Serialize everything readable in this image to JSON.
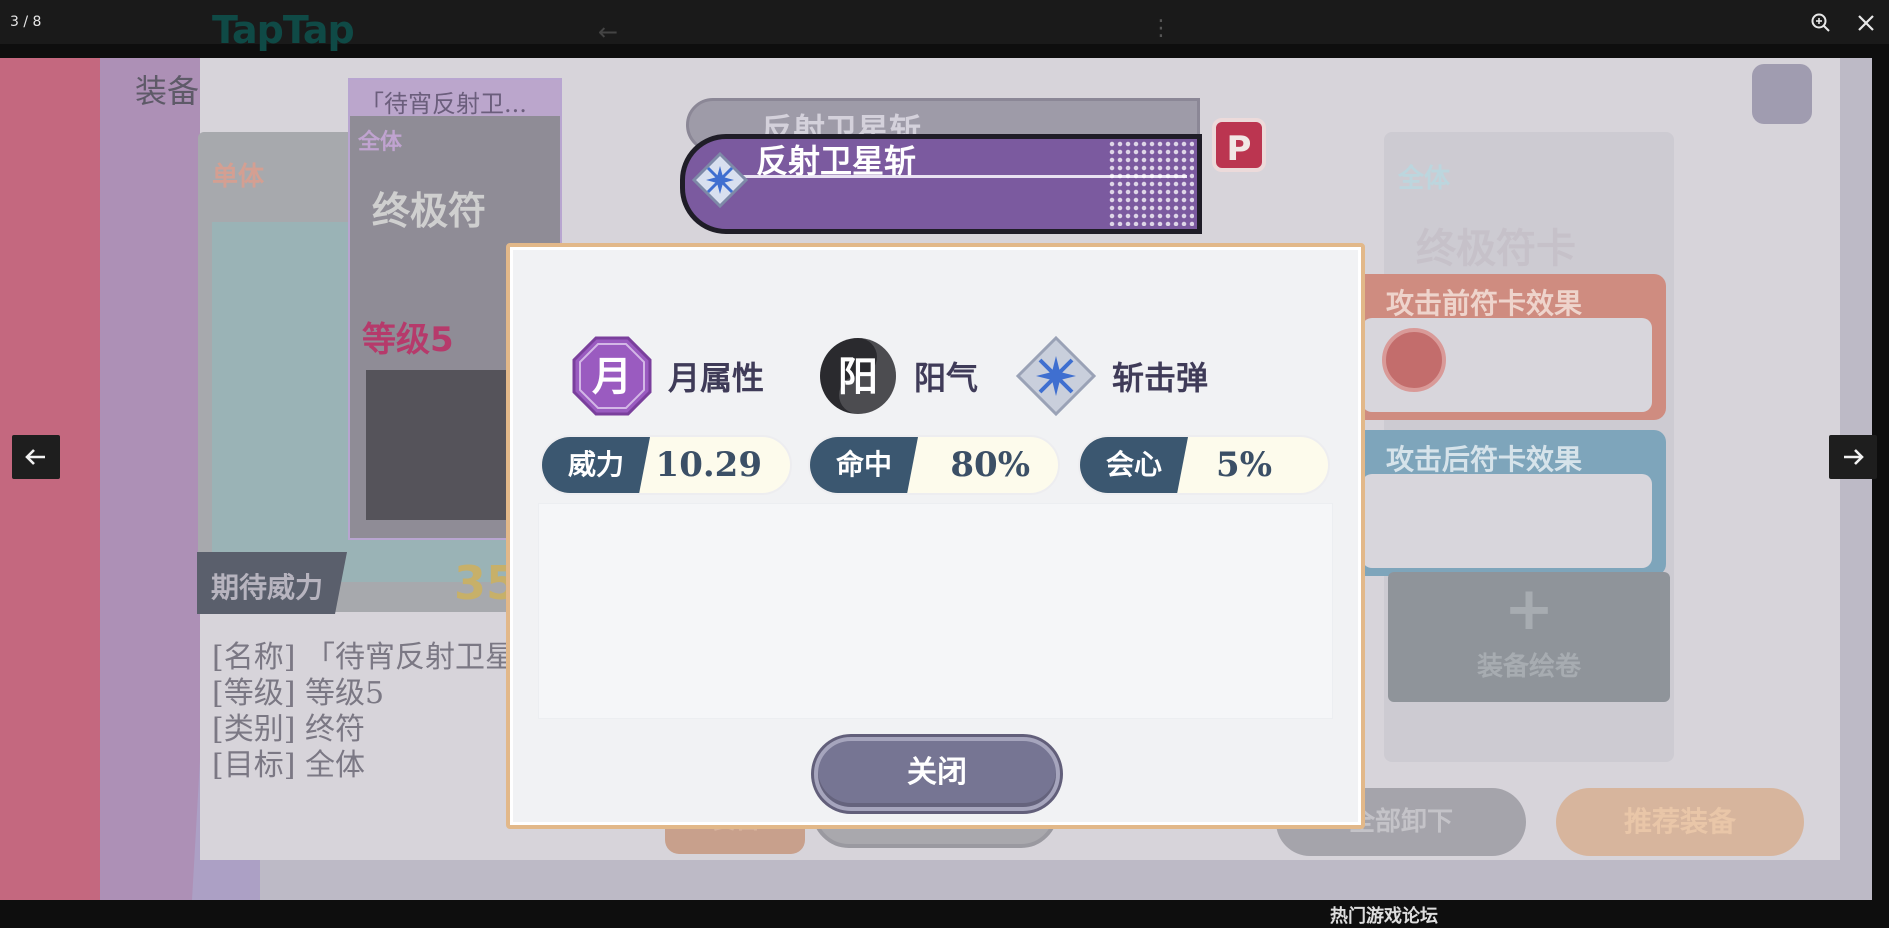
{
  "viewer": {
    "counter": "3 / 8",
    "zoom_icon": "magnifier-plus-icon",
    "close_icon": "close-icon",
    "prev_icon": "arrow-left-icon",
    "next_icon": "arrow-right-icon"
  },
  "background_page": {
    "logo": "TapTap",
    "side_heading": "热门游戏论坛"
  },
  "screenshot": {
    "section_title": "装备",
    "card_header": "「待宵反射卫...",
    "card_target": "全体",
    "card_name": "终极符",
    "card_level": "等级5",
    "left_badge": "单体",
    "expect_label": "期待威力",
    "expect_value": "35",
    "info_lines": [
      "[名称] 「待宵反射卫星斩",
      "[等级] 等级5",
      "[类别] 终符",
      "[目标] 全体"
    ],
    "right_card_target": "全体",
    "right_card_name": "终极符卡",
    "pre_effect_label": "攻击前符卡效果",
    "post_effect_label": "攻击后符卡效果",
    "add_scroll_label": "装备绘卷",
    "tab_equip": "装备",
    "bg_close": "关闭",
    "unequip_all": "全部卸下",
    "recommend_equip": "推荐装备",
    "p_badge": "P"
  },
  "ribbon": {
    "back_title": "反射卫星斩",
    "title": "反射卫星斩"
  },
  "modal": {
    "attributes": [
      {
        "icon_char": "月",
        "label": "月属性",
        "icon": "moon-attribute-icon"
      },
      {
        "icon_char": "阳",
        "label": "阳气",
        "icon": "yang-attribute-icon"
      },
      {
        "label": "斩击弹",
        "icon": "slash-bullet-icon"
      }
    ],
    "stats": [
      {
        "key": "威力",
        "value": "10.29"
      },
      {
        "key": "命中",
        "value": "80%"
      },
      {
        "key": "会心",
        "value": "5%"
      }
    ],
    "close_label": "关闭"
  },
  "colors": {
    "accent_purple": "#7b5a9f",
    "stat_header": "#3b5770",
    "modal_border": "#e2b889",
    "close_button": "#767593"
  }
}
